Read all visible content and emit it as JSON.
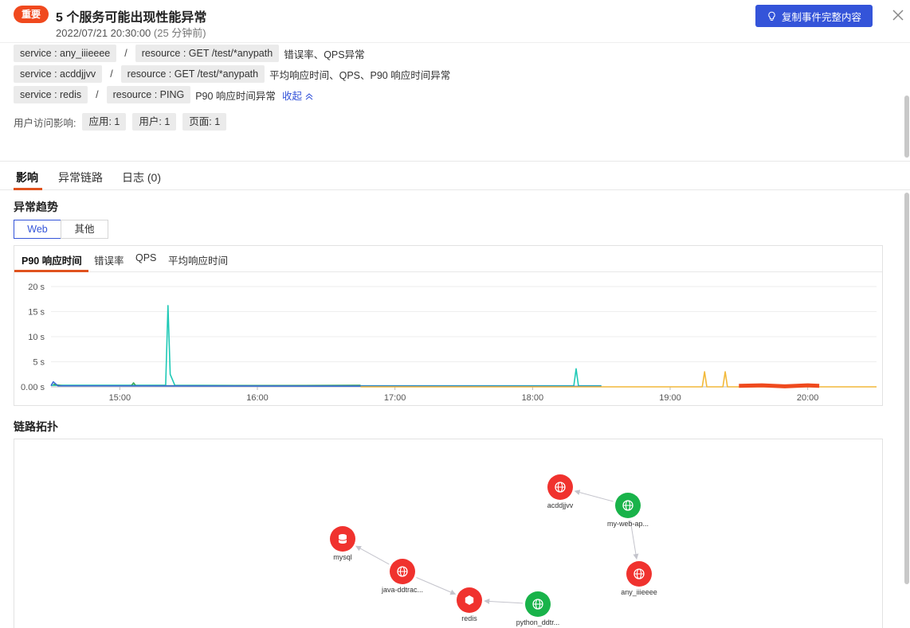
{
  "header": {
    "badge": "重要",
    "title": "5 个服务可能出现性能异常",
    "time": "2022/07/21 20:30:00",
    "ago": "(25 分钟前)",
    "copy_button": "复制事件完整内容"
  },
  "services": [
    {
      "service": "service : any_iiieeee",
      "resource": "resource : GET /test/*anypath",
      "desc": "错误率、QPS异常"
    },
    {
      "service": "service : acddjjvv",
      "resource": "resource : GET /test/*anypath",
      "desc": "平均响应时间、QPS、P90 响应时间异常"
    },
    {
      "service": "service : redis",
      "resource": "resource : PING",
      "desc": "P90 响应时间异常"
    }
  ],
  "separator": "/",
  "collapse_label": "收起",
  "impact": {
    "label": "用户访问影响:",
    "tags": [
      "应用: 1",
      "用户: 1",
      "页面: 1"
    ]
  },
  "tabs": [
    "影响",
    "异常链路",
    "日志 (0)"
  ],
  "trend_title": "异常趋势",
  "segment": [
    "Web",
    "其他"
  ],
  "chart_tabs": [
    "P90 响应时间",
    "错误率",
    "QPS",
    "平均响应时间"
  ],
  "topology_title": "链路拓扑",
  "colors": {
    "accent": "#3454d9",
    "badge": "#f0491e",
    "tab_underline": "#e0521e",
    "node_error": "#f0322e",
    "node_ok": "#19b34a",
    "series_cyan": "#1fc9b6",
    "series_green": "#3aa85a",
    "series_blue": "#3a6ad6",
    "series_orange": "#f2b93a",
    "series_red": "#ef4a1e"
  },
  "chart_data": {
    "type": "line",
    "title": "",
    "xlabel": "",
    "ylabel": "",
    "y_unit": "s",
    "yticks": [
      "20 s",
      "15 s",
      "10 s",
      "5 s",
      "0.00 s"
    ],
    "ylim": [
      0,
      20
    ],
    "xticks": [
      "15:00",
      "16:00",
      "17:00",
      "18:00",
      "19:00",
      "20:00"
    ],
    "xlim": [
      "14:30",
      "20:30"
    ],
    "grid": "horizontal",
    "series": [
      {
        "color": "cyan",
        "points": [
          [
            "14:30",
            0.3
          ],
          [
            "15:20",
            0.3
          ],
          [
            "15:21",
            16.2
          ],
          [
            "15:22",
            2.5
          ],
          [
            "15:24",
            0.3
          ],
          [
            "16:45",
            0.2
          ],
          [
            "18:18",
            0.2
          ],
          [
            "18:19",
            3.6
          ],
          [
            "18:20",
            0.2
          ],
          [
            "18:30",
            0.2
          ]
        ]
      },
      {
        "color": "green",
        "points": [
          [
            "14:31",
            0.5
          ],
          [
            "14:35",
            0.2
          ],
          [
            "15:05",
            0.2
          ],
          [
            "15:06",
            0.8
          ],
          [
            "15:07",
            0.2
          ],
          [
            "16:45",
            0.3
          ]
        ]
      },
      {
        "color": "blue",
        "points": [
          [
            "14:30",
            0.2
          ],
          [
            "14:31",
            1.0
          ],
          [
            "14:33",
            0.2
          ],
          [
            "18:10",
            0.1
          ],
          [
            "18:30",
            0.1
          ]
        ]
      },
      {
        "color": "orange",
        "points": [
          [
            "16:45",
            0.0
          ],
          [
            "19:14",
            0.0
          ],
          [
            "19:15",
            3.0
          ],
          [
            "19:16",
            0.0
          ],
          [
            "19:23",
            0.0
          ],
          [
            "19:24",
            3.0
          ],
          [
            "19:25",
            0.0
          ],
          [
            "20:30",
            0.0
          ]
        ]
      },
      {
        "color": "red",
        "points": [
          [
            "19:30",
            0.2
          ],
          [
            "19:40",
            0.3
          ],
          [
            "19:50",
            0.1
          ],
          [
            "20:00",
            0.3
          ],
          [
            "20:05",
            0.2
          ]
        ]
      }
    ]
  },
  "topology": {
    "nodes": [
      {
        "id": "acddjjvv",
        "label": "acddjjvv",
        "status": "error",
        "kind": "web"
      },
      {
        "id": "my-web",
        "label": "my-web-ap...",
        "status": "ok",
        "kind": "web"
      },
      {
        "id": "mysql",
        "label": "mysql",
        "status": "error",
        "kind": "db"
      },
      {
        "id": "java",
        "label": "java-ddtrac...",
        "status": "error",
        "kind": "web"
      },
      {
        "id": "any",
        "label": "any_iiieeee",
        "status": "error",
        "kind": "web"
      },
      {
        "id": "redis",
        "label": "redis",
        "status": "error",
        "kind": "cache"
      },
      {
        "id": "python",
        "label": "python_ddtr...",
        "status": "ok",
        "kind": "web"
      }
    ],
    "edges": [
      {
        "from": "my-web",
        "to": "acddjjvv"
      },
      {
        "from": "my-web",
        "to": "any"
      },
      {
        "from": "java",
        "to": "mysql"
      },
      {
        "from": "java",
        "to": "redis"
      },
      {
        "from": "python",
        "to": "redis"
      }
    ]
  }
}
